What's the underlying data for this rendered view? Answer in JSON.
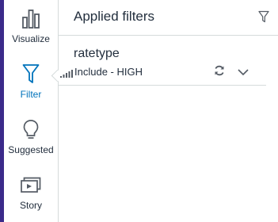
{
  "rail": {
    "items": [
      {
        "label": "Visualize",
        "icon": "bar-chart-icon",
        "active": false
      },
      {
        "label": "Filter",
        "icon": "filter-icon",
        "active": true
      },
      {
        "label": "Suggested",
        "icon": "lightbulb-icon",
        "active": false
      },
      {
        "label": "Story",
        "icon": "story-icon",
        "active": false
      }
    ]
  },
  "panel": {
    "title": "Applied filters",
    "filters": [
      {
        "field": "ratetype",
        "summary": "Include - HIGH"
      }
    ]
  },
  "colors": {
    "accent_bar": "#3b2a8a",
    "active_blue": "#0073bb",
    "text": "#232f3e",
    "icon_gray": "#545b64",
    "border": "#d5dbdb"
  }
}
